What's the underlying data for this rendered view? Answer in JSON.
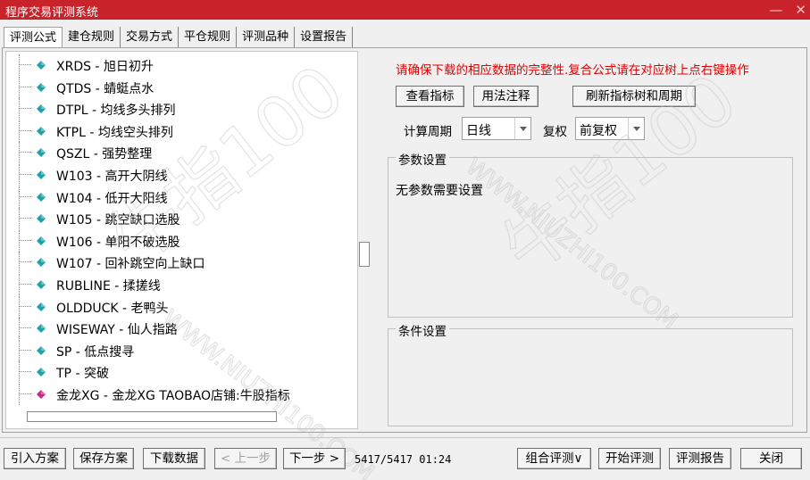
{
  "window": {
    "title": "程序交易评测系统",
    "minimize_glyph": "—",
    "close_glyph": "✕"
  },
  "tabs": [
    {
      "label": "评测公式",
      "active": true
    },
    {
      "label": "建仓规则",
      "active": false
    },
    {
      "label": "交易方式",
      "active": false
    },
    {
      "label": "平仓规则",
      "active": false
    },
    {
      "label": "评测品种",
      "active": false
    },
    {
      "label": "设置报告",
      "active": false
    }
  ],
  "tree": {
    "items": [
      {
        "label": "XRDS - 旭日初升",
        "icon": "cyan-gem-icon"
      },
      {
        "label": "QTDS - 蜻蜓点水",
        "icon": "cyan-gem-icon"
      },
      {
        "label": "DTPL - 均线多头排列",
        "icon": "cyan-gem-icon"
      },
      {
        "label": "KTPL - 均线空头排列",
        "icon": "cyan-gem-icon"
      },
      {
        "label": "QSZL - 强势整理",
        "icon": "cyan-gem-icon"
      },
      {
        "label": "W103 - 高开大阴线",
        "icon": "cyan-gem-icon"
      },
      {
        "label": "W104 - 低开大阳线",
        "icon": "cyan-gem-icon"
      },
      {
        "label": "W105 - 跳空缺口选股",
        "icon": "cyan-gem-icon"
      },
      {
        "label": "W106 - 单阳不破选股",
        "icon": "cyan-gem-icon"
      },
      {
        "label": "W107 - 回补跳空向上缺口",
        "icon": "cyan-gem-icon"
      },
      {
        "label": "RUBLINE - 揉搓线",
        "icon": "cyan-gem-icon"
      },
      {
        "label": "OLDDUCK - 老鸭头",
        "icon": "cyan-gem-icon"
      },
      {
        "label": "WISEWAY - 仙人指路",
        "icon": "cyan-gem-icon"
      },
      {
        "label": "SP - 低点搜寻",
        "icon": "cyan-gem-icon"
      },
      {
        "label": "TP - 突破",
        "icon": "cyan-gem-icon"
      },
      {
        "label": "金龙XG - 金龙XG TAOBAO店铺:牛股指标",
        "icon": "magenta-gem-icon"
      }
    ]
  },
  "notice": "请确保下载的相应数据的完整性.复合公式请在对应树上点右键操作",
  "buttons": {
    "view_indicator": "查看指标",
    "usage_notes": "用法注释",
    "refresh_tree": "刷新指标树和周期",
    "import_plan": "引入方案",
    "save_plan": "保存方案",
    "download_data": "下载数据",
    "prev_step": "< 上一步",
    "next_step": "下一步 >",
    "combo_eval": "组合评测∨",
    "start_eval": "开始评测",
    "eval_report": "评测报告",
    "close": "关闭"
  },
  "period": {
    "label": "计算周期",
    "value": "日线"
  },
  "adjust": {
    "label": "复权",
    "value": "前复权"
  },
  "params": {
    "legend": "参数设置",
    "content": "无参数需要设置"
  },
  "conditions": {
    "legend": "条件设置"
  },
  "status": "5417/5417 01:24",
  "watermark": {
    "brand": "牛指100",
    "url": "WWW.NIUZHI100.COM"
  },
  "colors": {
    "titlebar": "#c8222a",
    "notice": "#e00000",
    "gem_cyan": "#1aa3a8",
    "gem_magenta": "#c8288a"
  }
}
